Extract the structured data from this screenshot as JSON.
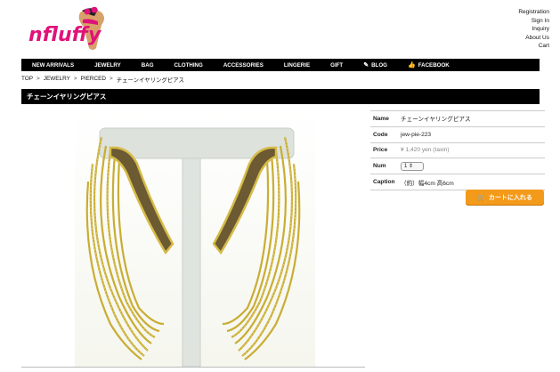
{
  "brand": {
    "logo_text": "nfluffy"
  },
  "toplinks": [
    "Registration",
    "Sign In",
    "Inquiry",
    "About Us",
    "Cart"
  ],
  "nav": [
    {
      "label": "NEW ARRIVALS",
      "icon": ""
    },
    {
      "label": "JEWELRY",
      "icon": ""
    },
    {
      "label": "BAG",
      "icon": ""
    },
    {
      "label": "CLOTHING",
      "icon": ""
    },
    {
      "label": "ACCESSORIES",
      "icon": ""
    },
    {
      "label": "LINGERIE",
      "icon": ""
    },
    {
      "label": "GIFT",
      "icon": ""
    },
    {
      "label": "BLOG",
      "icon": "pencil-icon"
    },
    {
      "label": "FACEBOOK",
      "icon": "thumbs-up-icon"
    }
  ],
  "breadcrumb": [
    "TOP",
    "JEWELRY",
    "PIERCED",
    "チェーンイヤリングピアス"
  ],
  "breadcrumb_sep": ">",
  "page_title": "チェーンイヤリングピアス",
  "product": {
    "name_label": "Name",
    "name": "チェーンイヤリングピアス",
    "code_label": "Code",
    "code": "jew-pie-223",
    "price_label": "Price",
    "price": "¥ 1,420",
    "price_note": "yen (taxin)",
    "num_label": "Num",
    "num": "1",
    "caption_label": "Caption",
    "caption": "（約）幅4cm 高6cm"
  },
  "cart_button": {
    "label": "カートに入れる",
    "icon": "cart-icon"
  },
  "colors": {
    "nav_bg": "#000000",
    "cart_bg": "#f49a1a",
    "logo_pink": "#e0127a",
    "gold": "#d2b43a"
  }
}
